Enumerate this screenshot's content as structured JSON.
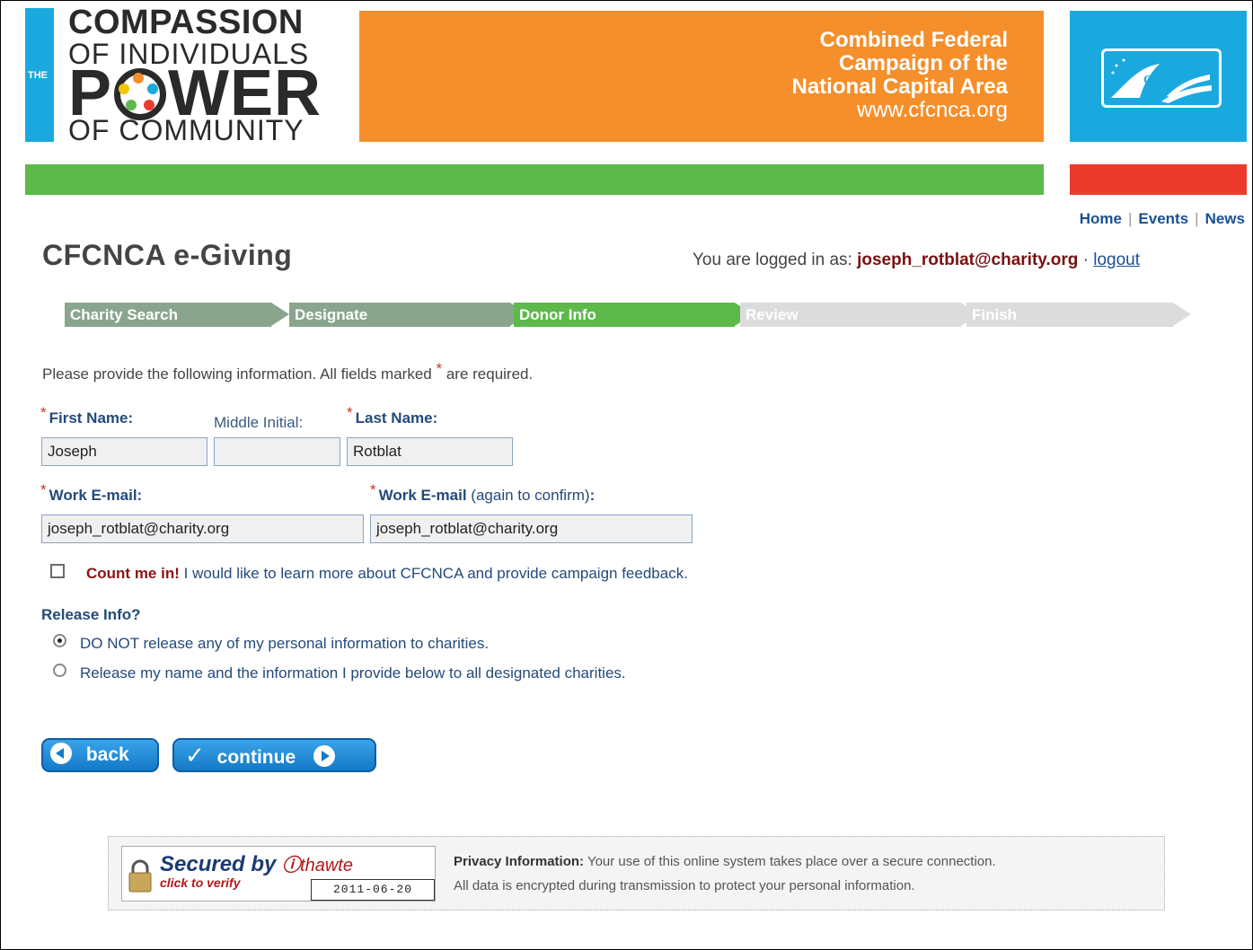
{
  "banner": {
    "logo_the": "THE",
    "logo_line1": "COMPASSION",
    "logo_line2": "OF INDIVIDUALS",
    "logo_power_p": "P",
    "logo_power_rest": "WER",
    "logo_line4": "OF COMMUNITY",
    "cfc_line1": "Combined Federal",
    "cfc_line2": "Campaign of the",
    "cfc_line3": "National Capital Area",
    "cfc_url": "www.cfcnca.org",
    "cfc_badge": "CFC",
    "colors": {
      "orange": "#f58f2b",
      "blue": "#1aa9de",
      "green": "#5cb94a",
      "red": "#ec3a2c"
    }
  },
  "nav": {
    "home": "Home",
    "events": "Events",
    "news": "News",
    "sep": "|"
  },
  "page_title": "CFCNCA e-Giving",
  "login": {
    "prefix": "You are logged in as:",
    "user": "joseph_rotblat@charity.org",
    "dot": "·",
    "logout": "logout"
  },
  "steps": [
    {
      "label": "Charity Search",
      "state": "done"
    },
    {
      "label": "Designate",
      "state": "done"
    },
    {
      "label": "Donor Info",
      "state": "current"
    },
    {
      "label": "Review",
      "state": "future"
    },
    {
      "label": "Finish",
      "state": "future"
    }
  ],
  "intro": {
    "before": "Please provide the following information. All fields marked",
    "star": "*",
    "after": "are required."
  },
  "form": {
    "first_name_label": "First Name:",
    "first_name_value": "Joseph",
    "middle_initial_label": "Middle Initial:",
    "middle_initial_value": "",
    "last_name_label": "Last Name:",
    "last_name_value": "Rotblat",
    "email_label": "Work E-mail:",
    "email_value": "joseph_rotblat@charity.org",
    "email_confirm_label": "Work E-mail",
    "email_confirm_note": "(again to confirm)",
    "email_confirm_colon": ":",
    "email_confirm_value": "joseph_rotblat@charity.org",
    "required_star": "*"
  },
  "count_me": {
    "bold": "Count me in!",
    "text": "I would like to learn more about CFCNCA and provide campaign feedback.",
    "checked": false
  },
  "release": {
    "title": "Release Info?",
    "options": [
      {
        "label": "DO NOT release any of my personal information to charities.",
        "selected": true
      },
      {
        "label": "Release my name and the information I provide below to all designated charities.",
        "selected": false
      }
    ]
  },
  "buttons": {
    "back": "back",
    "continue_check": "✓",
    "continue": "continue"
  },
  "footer": {
    "seal_title": "Secured by",
    "seal_brand": "thawte",
    "seal_sub": "click to verify",
    "seal_date": "2011-06-20",
    "privacy_label": "Privacy Information:",
    "privacy_text1": "Your use of this online system takes place over a secure connection.",
    "privacy_text2": "All data is encrypted during transmission to protect your personal information."
  }
}
